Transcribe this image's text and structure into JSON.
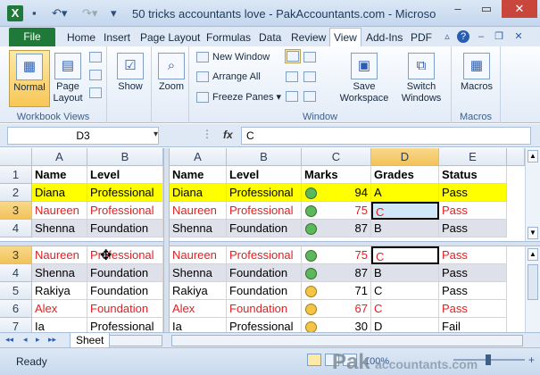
{
  "window": {
    "title": "50 tricks accountants love - PakAccountants.com - Microso",
    "logo": "X"
  },
  "tabs": [
    "File",
    "Home",
    "Insert",
    "Page Layout",
    "Formulas",
    "Data",
    "Review",
    "View",
    "Add-Ins",
    "PDF"
  ],
  "ribbon": {
    "workbook_views": {
      "label": "Workbook Views",
      "normal": "Normal",
      "page_layout": "Page Layout"
    },
    "show": {
      "label": "Show"
    },
    "zoom": {
      "label": "Zoom"
    },
    "window": {
      "label": "Window",
      "new_window": "New Window",
      "arrange_all": "Arrange All",
      "freeze_panes": "Freeze Panes",
      "save_workspace": "Save Workspace",
      "switch_windows": "Switch Windows"
    },
    "macros": {
      "label": "Macros",
      "button": "Macros"
    }
  },
  "formula_bar": {
    "name_box": "D3",
    "fx": "fx",
    "value": "C"
  },
  "left_pane": {
    "columns": [
      "A",
      "B"
    ],
    "top_rows": [
      {
        "row": "1",
        "a": "Name",
        "b": "Level"
      },
      {
        "row": "2",
        "a": "Diana",
        "b": "Professional"
      },
      {
        "row": "3",
        "a": "Naureen",
        "b": "Professional"
      },
      {
        "row": "4",
        "a": "Shenna",
        "b": "Foundation"
      }
    ],
    "bottom_rows": [
      {
        "row": "3",
        "a": "Naureen",
        "b": "Professional"
      },
      {
        "row": "4",
        "a": "Shenna",
        "b": "Foundation"
      },
      {
        "row": "5",
        "a": "Rakiya",
        "b": "Foundation"
      },
      {
        "row": "6",
        "a": "Alex",
        "b": "Foundation"
      },
      {
        "row": "7",
        "a": "Ia",
        "b": "Professional"
      }
    ]
  },
  "right_pane": {
    "columns": [
      "A",
      "B",
      "C",
      "D",
      "E"
    ],
    "top_rows": [
      {
        "a": "Name",
        "b": "Level",
        "c": "Marks",
        "d": "Grades",
        "e": "Status"
      },
      {
        "a": "Diana",
        "b": "Professional",
        "c": "94",
        "d": "A",
        "e": "Pass"
      },
      {
        "a": "Naureen",
        "b": "Professional",
        "c": "75",
        "d": "C",
        "e": "Pass"
      },
      {
        "a": "Shenna",
        "b": "Foundation",
        "c": "87",
        "d": "B",
        "e": "Pass"
      }
    ],
    "bottom_rows": [
      {
        "a": "Naureen",
        "b": "Professional",
        "c": "75",
        "d": "C",
        "e": "Pass"
      },
      {
        "a": "Shenna",
        "b": "Foundation",
        "c": "87",
        "d": "B",
        "e": "Pass"
      },
      {
        "a": "Rakiya",
        "b": "Foundation",
        "c": "71",
        "d": "C",
        "e": "Pass"
      },
      {
        "a": "Alex",
        "b": "Foundation",
        "c": "67",
        "d": "C",
        "e": "Pass"
      },
      {
        "a": "Ia",
        "b": "Professional",
        "c": "30",
        "d": "D",
        "e": "Fail"
      }
    ]
  },
  "sheet_tab": "Sheet",
  "status": {
    "ready": "Ready",
    "zoom": "100%",
    "watermark_a": "Pak",
    "watermark_b": "accountants.com"
  }
}
